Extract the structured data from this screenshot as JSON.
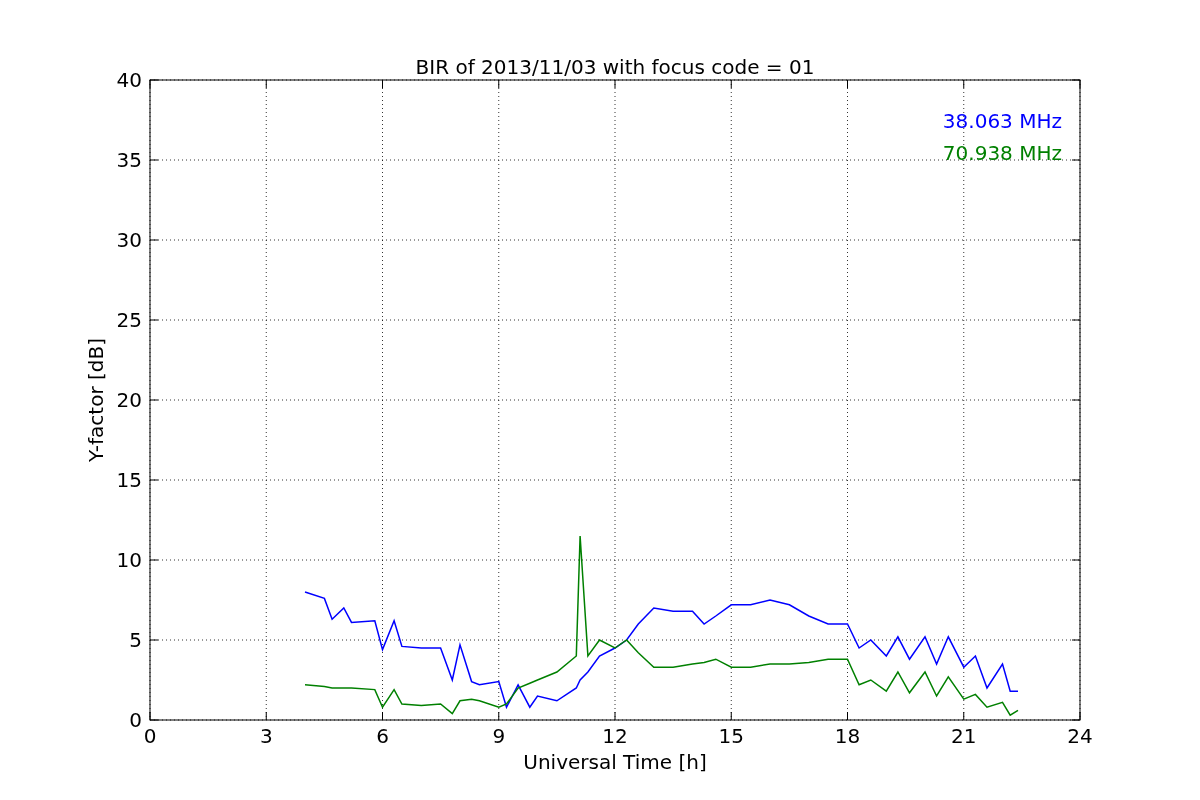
{
  "figure": {
    "chart_data": {
      "type": "line",
      "title": "BIR of 2013/11/03 with focus code = 01",
      "xlabel": "Universal Time [h]",
      "ylabel": "Y-factor [dB]",
      "x": [
        4,
        4.5,
        4.7,
        5,
        5.2,
        5.8,
        6,
        6.3,
        6.5,
        7,
        7.5,
        7.8,
        8,
        8.3,
        8.5,
        9,
        9.2,
        9.5,
        9.8,
        10,
        10.5,
        11,
        11.1,
        11.3,
        11.6,
        12,
        12.3,
        12.6,
        13,
        13.5,
        14,
        14.3,
        14.6,
        15,
        15.5,
        16,
        16.5,
        17,
        17.5,
        18,
        18.3,
        18.6,
        19,
        19.3,
        19.6,
        20,
        20.3,
        20.6,
        21,
        21.3,
        21.6,
        22,
        22.2,
        22.4
      ],
      "series": [
        {
          "name": "38.063 MHz",
          "color": "#0000ff",
          "values": [
            8,
            7.6,
            6.3,
            7,
            6.1,
            6.2,
            4.4,
            6.2,
            4.6,
            4.5,
            4.5,
            2.5,
            4.7,
            2.4,
            2.2,
            2.4,
            0.8,
            2.2,
            0.8,
            1.5,
            1.2,
            2,
            2.5,
            3,
            4,
            4.5,
            5,
            6,
            7,
            6.8,
            6.8,
            6,
            6.5,
            7.2,
            7.2,
            7.5,
            7.2,
            6.5,
            6,
            6,
            4.5,
            5,
            4,
            5.2,
            3.8,
            5.2,
            3.5,
            5.2,
            3.3,
            4,
            2,
            3.5,
            1.8,
            1.8
          ]
        },
        {
          "name": "70.938 MHz",
          "color": "#008000",
          "values": [
            2.2,
            2.1,
            2,
            2,
            2,
            1.9,
            0.8,
            1.9,
            1,
            0.9,
            1,
            0.4,
            1.2,
            1.3,
            1.2,
            0.8,
            1,
            2,
            2.3,
            2.5,
            3,
            4,
            11.5,
            4,
            5,
            4.5,
            5,
            4.2,
            3.3,
            3.3,
            3.5,
            3.6,
            3.8,
            3.3,
            3.3,
            3.5,
            3.5,
            3.6,
            3.8,
            3.8,
            2.2,
            2.5,
            1.8,
            3,
            1.7,
            3,
            1.5,
            2.7,
            1.3,
            1.6,
            0.8,
            1.1,
            0.3,
            0.6
          ]
        }
      ],
      "grid": true,
      "xlim": [
        0,
        24
      ],
      "ylim": [
        0,
        40
      ],
      "xticks": [
        0,
        3,
        6,
        9,
        12,
        15,
        18,
        21,
        24
      ],
      "yticks": [
        0,
        5,
        10,
        15,
        20,
        25,
        30,
        35,
        40
      ]
    }
  }
}
